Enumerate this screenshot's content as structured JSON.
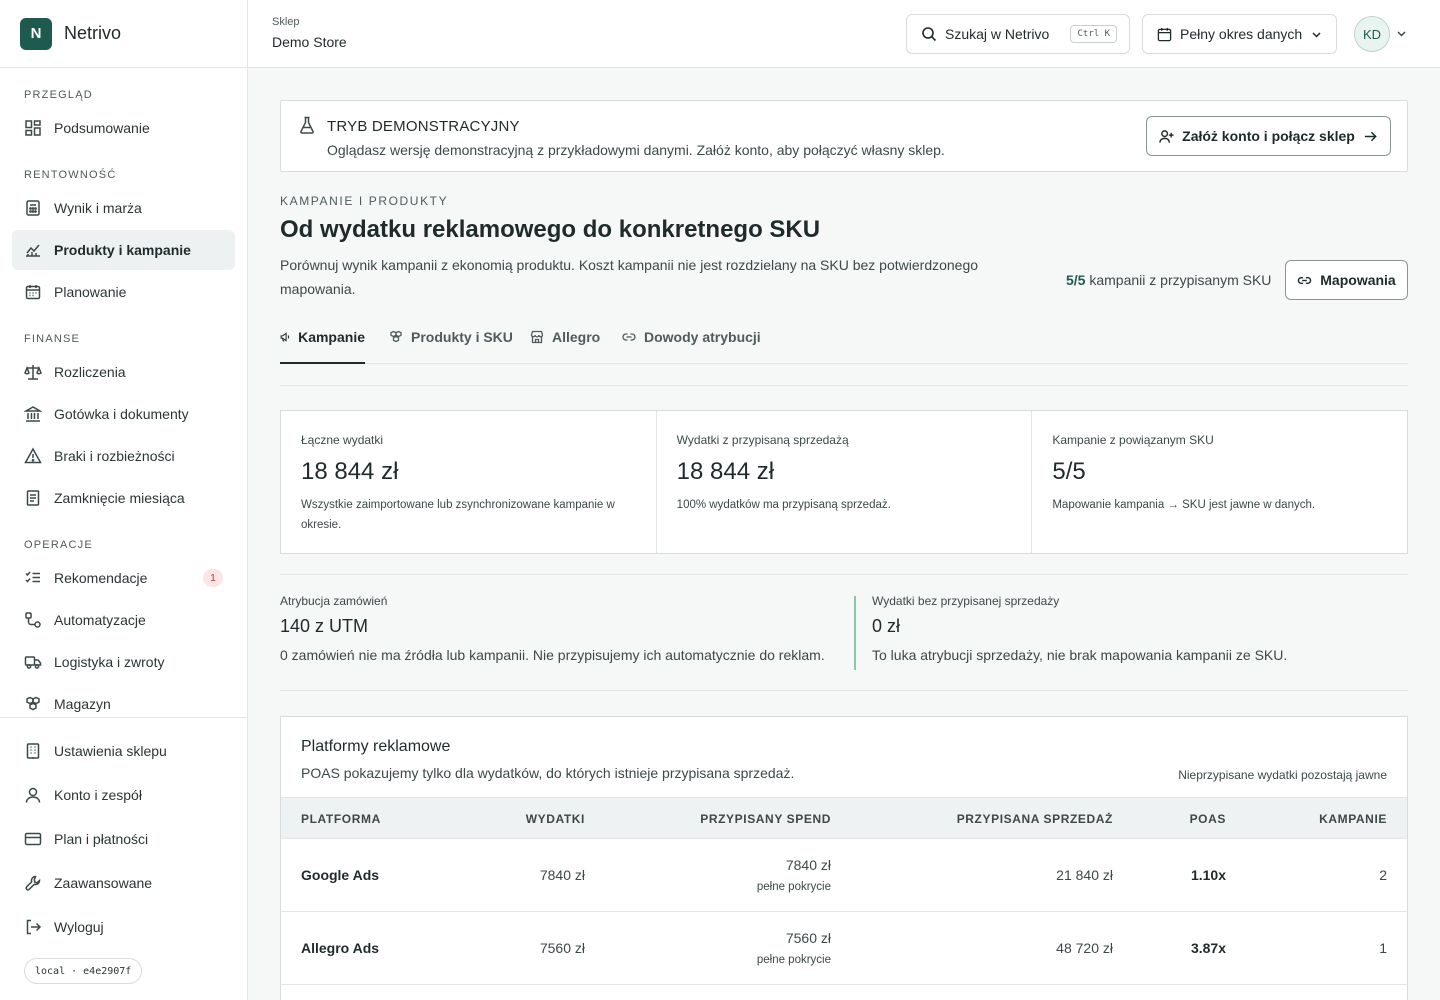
{
  "brand": {
    "logo_letter": "N",
    "name": "Netrivo",
    "color": "#1f5a4f"
  },
  "sidebar": {
    "sections": [
      {
        "title": "PRZEGLĄD",
        "items": [
          {
            "label": "Podsumowanie",
            "icon": "grid-icon"
          }
        ]
      },
      {
        "title": "RENTOWNOŚĆ",
        "items": [
          {
            "label": "Wynik i marża",
            "icon": "calculator-icon"
          },
          {
            "label": "Produkty i kampanie",
            "icon": "chart-line-icon",
            "active": true
          },
          {
            "label": "Planowanie",
            "icon": "calendar-icon"
          }
        ]
      },
      {
        "title": "FINANSE",
        "items": [
          {
            "label": "Rozliczenia",
            "icon": "scale-icon"
          },
          {
            "label": "Gotówka i dokumenty",
            "icon": "bank-icon"
          },
          {
            "label": "Braki i rozbieżności",
            "icon": "warning-icon"
          },
          {
            "label": "Zamknięcie miesiąca",
            "icon": "document-icon"
          }
        ]
      },
      {
        "title": "OPERACJE",
        "items": [
          {
            "label": "Rekomendacje",
            "icon": "checklist-icon",
            "badge": "1"
          },
          {
            "label": "Automatyzacje",
            "icon": "workflow-icon"
          },
          {
            "label": "Logistyka i zwroty",
            "icon": "truck-icon"
          },
          {
            "label": "Magazyn",
            "icon": "boxes-icon"
          }
        ]
      }
    ],
    "bottom": [
      {
        "label": "Ustawienia sklepu",
        "icon": "building-icon"
      },
      {
        "label": "Konto i zespół",
        "icon": "user-icon"
      },
      {
        "label": "Plan i płatności",
        "icon": "credit-card-icon"
      },
      {
        "label": "Zaawansowane",
        "icon": "wrench-icon"
      },
      {
        "label": "Wyloguj",
        "icon": "logout-icon"
      }
    ],
    "version": "local · e4e2907f"
  },
  "header": {
    "store_label": "Sklep",
    "store_name": "Demo Store",
    "search_placeholder": "Szukaj w Netrivo",
    "search_shortcut": "Ctrl K",
    "period": "Pełny okres danych",
    "avatar": "KD"
  },
  "demo": {
    "title": "TRYB DEMONSTRACYJNY",
    "text": "Oglądasz wersję demonstracyjną z przykładowymi danymi. Załóż konto, aby połączyć własny sklep.",
    "button": "Załóż konto i połącz sklep"
  },
  "page": {
    "eyebrow": "KAMPANIE I PRODUKTY",
    "title": "Od wydatku reklamowego do konkretnego SKU",
    "description": "Porównuj wynik kampanii z ekonomią produktu. Koszt kampanii nie jest rozdzielany na SKU bez potwierdzonego mapowania.",
    "sku_count": "5/5",
    "sku_text": " kampanii z przypisanym SKU",
    "mapping_button": "Mapowania"
  },
  "tabs": [
    {
      "label": "Kampanie",
      "icon": "megaphone-icon",
      "active": true
    },
    {
      "label": "Produkty i SKU",
      "icon": "boxes-icon"
    },
    {
      "label": "Allegro",
      "icon": "store-icon"
    },
    {
      "label": "Dowody atrybucji",
      "icon": "link-icon"
    }
  ],
  "kpis": [
    {
      "label": "Łączne wydatki",
      "value": "18 844 zł",
      "note": "Wszystkie zaimportowane lub zsynchronizowane kampanie w okresie."
    },
    {
      "label": "Wydatki z przypisaną sprzedażą",
      "value": "18 844 zł",
      "note": "100% wydatków ma przypisaną sprzedaż."
    },
    {
      "label": "Kampanie z powiązanym SKU",
      "value": "5/5",
      "note": "Mapowanie kampania → SKU jest jawne w danych."
    }
  ],
  "attribution": [
    {
      "label": "Atrybucja zamówień",
      "value": "140 z UTM",
      "note": "0 zamówień nie ma źródła lub kampanii. Nie przypisujemy ich automatycznie do reklam."
    },
    {
      "label": "Wydatki bez przypisanej sprzedaży",
      "value": "0 zł",
      "note": "To luka atrybucji sprzedaży, nie brak mapowania kampanii ze SKU."
    }
  ],
  "platforms": {
    "title": "Platformy reklamowe",
    "subtitle": "POAS pokazujemy tylko dla wydatków, do których istnieje przypisana sprzedaż.",
    "note": "Nieprzypisane wydatki pozostają jawne",
    "columns": [
      "PLATFORMA",
      "WYDATKI",
      "PRZYPISANY SPEND",
      "PRZYPISANA SPRZEDAŻ",
      "POAS",
      "KAMPANIE"
    ],
    "rows": [
      {
        "platform": "Google Ads",
        "spend": "7840 zł",
        "assigned_spend": "7840 zł",
        "coverage": "pełne pokrycie",
        "assigned_sales": "21 840 zł",
        "poas": "1.10x",
        "campaigns": "2"
      },
      {
        "platform": "Allegro Ads",
        "spend": "7560 zł",
        "assigned_spend": "7560 zł",
        "coverage": "pełne pokrycie",
        "assigned_sales": "48 720 zł",
        "poas": "3.87x",
        "campaigns": "1"
      }
    ]
  }
}
